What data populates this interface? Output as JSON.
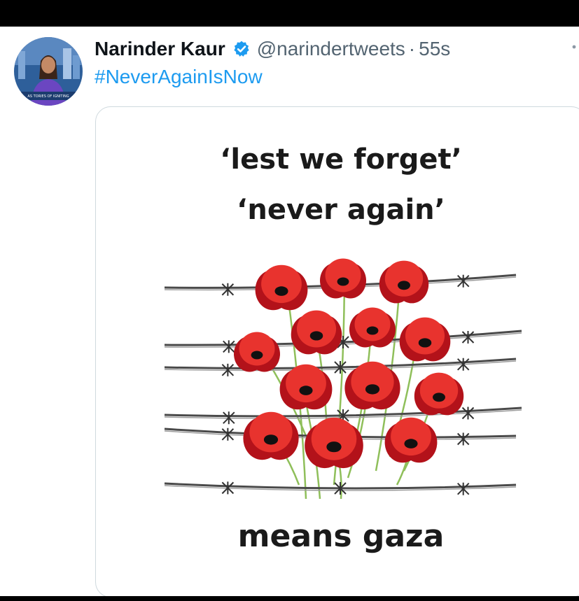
{
  "tweet": {
    "author_name": "Narinder Kaur",
    "handle": "@narindertweets",
    "separator": "·",
    "time": "55s",
    "text": "#NeverAgainIsNow",
    "avatar_caption": "AS TORIES OF IGNITING"
  },
  "image": {
    "line1": "‘lest we forget’",
    "line2": "‘never again’",
    "line3": "means gaza"
  },
  "colors": {
    "hashtag": "#1d9bf0",
    "verified": "#1d9bf0",
    "poppy": "#e8332e",
    "poppy_dark": "#b3121a"
  },
  "icons": [
    "verified-badge-icon",
    "more-options-icon",
    "avatar"
  ]
}
